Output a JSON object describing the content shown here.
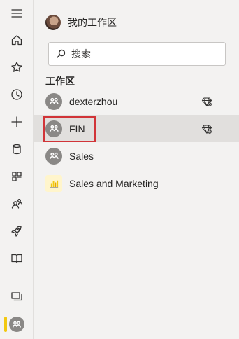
{
  "rail": {
    "items": [
      {
        "icon": "hamburger-menu-icon"
      },
      {
        "icon": "home-icon"
      },
      {
        "icon": "star-icon"
      },
      {
        "icon": "clock-icon"
      },
      {
        "icon": "plus-icon"
      },
      {
        "icon": "datahub-cylinder-icon"
      },
      {
        "icon": "apps-icon"
      },
      {
        "icon": "shared-with-me-icon"
      },
      {
        "icon": "rocket-icon"
      },
      {
        "icon": "learn-book-icon"
      },
      {
        "icon": "workspaces-icon"
      },
      {
        "icon": "current-workspace-icon"
      }
    ],
    "accent_color": "#f2c811"
  },
  "panel": {
    "my_workspace_label": "我的工作区",
    "search_placeholder": "搜索",
    "section_title": "工作区",
    "workspaces": [
      {
        "name": "dexterzhou",
        "icon": "workspace-group-icon",
        "premium": true,
        "selected": false
      },
      {
        "name": "FIN",
        "icon": "workspace-group-icon",
        "premium": true,
        "selected": true
      },
      {
        "name": "Sales",
        "icon": "workspace-group-icon",
        "premium": false,
        "selected": false
      },
      {
        "name": "Sales and Marketing",
        "icon": "bar-chart-app-icon",
        "premium": false,
        "selected": false
      }
    ],
    "highlight_color": "#d13438"
  }
}
